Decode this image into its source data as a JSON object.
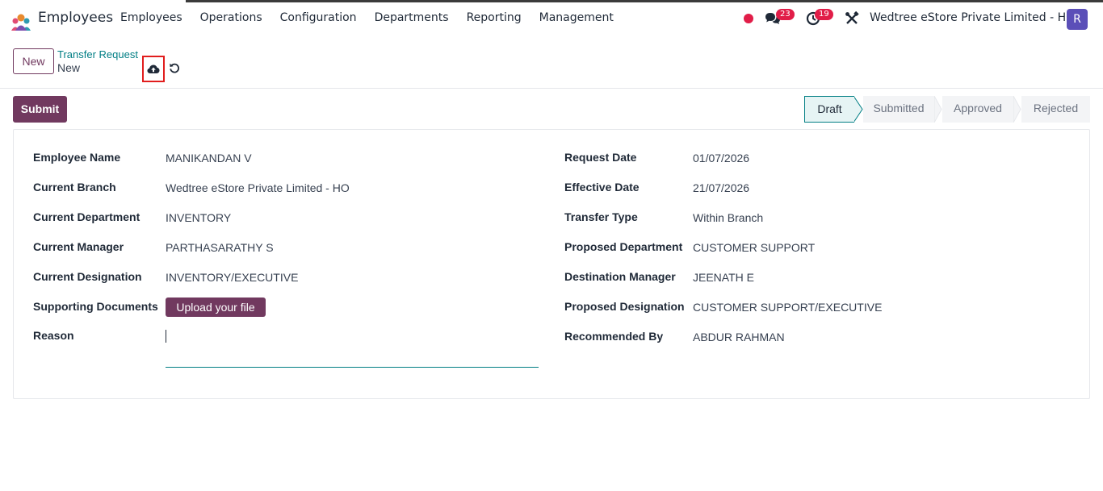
{
  "navbar": {
    "app_name": "Employees",
    "menu": [
      "Employees",
      "Operations",
      "Configuration",
      "Departments",
      "Reporting",
      "Management"
    ],
    "chat_badge": "23",
    "activity_badge": "19",
    "company": "Wedtree eStore Private Limited - HO",
    "avatar_letter": "R",
    "icons": [
      "app-logo-icon",
      "status-dot-icon",
      "chat-icon",
      "clock-icon",
      "tools-icon"
    ]
  },
  "control": {
    "new_label": "New",
    "breadcrumb_parent": "Transfer Request",
    "breadcrumb_current": "New",
    "icons": [
      "cloud-upload-icon",
      "undo-icon"
    ]
  },
  "action": {
    "submit_label": "Submit"
  },
  "status": {
    "stages": [
      "Draft",
      "Submitted",
      "Approved",
      "Rejected"
    ],
    "active": "Draft"
  },
  "form": {
    "left": [
      {
        "label": "Employee Name",
        "value": "MANIKANDAN V"
      },
      {
        "label": "Current Branch",
        "value": "Wedtree eStore Private Limited - HO"
      },
      {
        "label": "Current Department",
        "value": "INVENTORY"
      },
      {
        "label": "Current Manager",
        "value": "PARTHASARATHY S"
      },
      {
        "label": "Current Designation",
        "value": "INVENTORY/EXECUTIVE"
      },
      {
        "label": "Supporting Documents",
        "value": "Upload your file"
      },
      {
        "label": "Reason",
        "value": ""
      }
    ],
    "right": [
      {
        "label": "Request Date",
        "value": "01/07/2026"
      },
      {
        "label": "Effective Date",
        "value": "21/07/2026"
      },
      {
        "label": "Transfer Type",
        "value": "Within Branch"
      },
      {
        "label": "Proposed Department",
        "value": "CUSTOMER SUPPORT"
      },
      {
        "label": "Destination Manager",
        "value": "JEENATH E"
      },
      {
        "label": "Proposed Designation",
        "value": "CUSTOMER SUPPORT/EXECUTIVE"
      },
      {
        "label": "Recommended By",
        "value": "ABDUR RAHMAN"
      }
    ]
  },
  "colors": {
    "brand": "#71395f",
    "link": "#017e84",
    "badge": "#e11d48",
    "avatar": "#5b4fb8",
    "highlight_box": "#e11d1d"
  }
}
